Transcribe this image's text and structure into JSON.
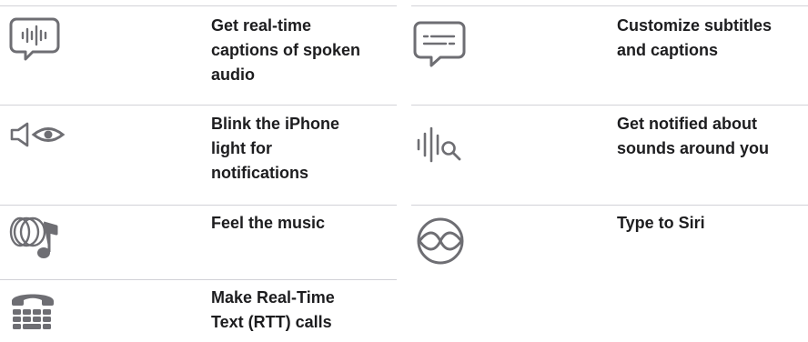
{
  "features": [
    {
      "icon": "live-captions-icon",
      "label": "Get real-time\ncaptions of spoken\naudio"
    },
    {
      "icon": "subtitles-icon",
      "label": "Customize subtitles\nand captions"
    },
    {
      "icon": "led-flash-icon",
      "label": "Blink the iPhone\nlight for\nnotifications"
    },
    {
      "icon": "sound-recognition-icon",
      "label": "Get notified about\nsounds around you"
    },
    {
      "icon": "music-haptics-icon",
      "label": "Feel the music"
    },
    {
      "icon": "type-to-siri-icon",
      "label": "Type to Siri"
    },
    {
      "icon": "rtt-phone-icon",
      "label": "Make Real-Time\nText (RTT) calls"
    }
  ],
  "colors": {
    "icon": "#6e6e73",
    "text": "#1d1d1f",
    "divider": "#d2d2d7"
  }
}
